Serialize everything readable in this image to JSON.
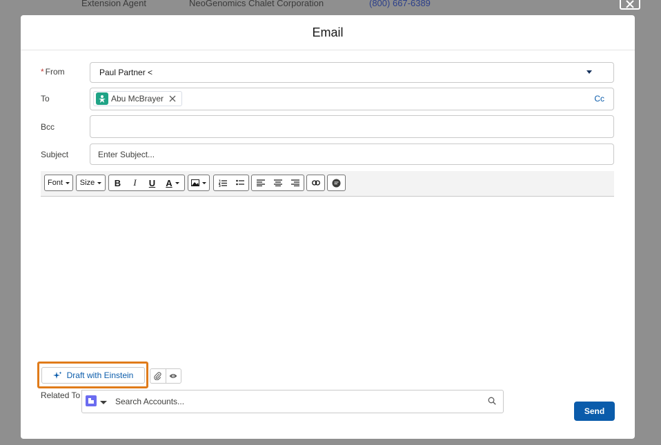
{
  "background_row": {
    "title": "Extension Agent",
    "company": "NeoGenomics Chalet Corporation",
    "phone": "(800) 667-6389"
  },
  "modal": {
    "title": "Email",
    "from": {
      "label": "From",
      "required_marker": "*",
      "value": "Paul Partner <"
    },
    "to": {
      "label": "To",
      "recipient": "Abu McBrayer",
      "cc_label": "Cc"
    },
    "bcc": {
      "label": "Bcc",
      "value": ""
    },
    "subject": {
      "label": "Subject",
      "placeholder": "Enter Subject...",
      "value": ""
    },
    "toolbar": {
      "font_label": "Font",
      "size_label": "Size",
      "bold": "B",
      "italic": "I",
      "underline": "U",
      "text_color": "A"
    },
    "body": "",
    "draft_with_einstein": "Draft with Einstein",
    "related_to": {
      "label": "Related To",
      "placeholder": "Search Accounts..."
    },
    "send_label": "Send"
  },
  "colors": {
    "brand_blue": "#0b5cab",
    "highlight_orange": "#e07b1a",
    "contact_icon": "#1fa386",
    "required_red": "#c23934",
    "account_icon": "#6b6cf0"
  },
  "icons": {
    "close": "close-icon",
    "contact": "contact-icon",
    "remove": "close-icon",
    "dropdown": "chevron-down-icon",
    "einstein": "sparkle-icon",
    "attach": "paperclip-icon",
    "preview": "eye-icon",
    "search": "search-icon"
  }
}
